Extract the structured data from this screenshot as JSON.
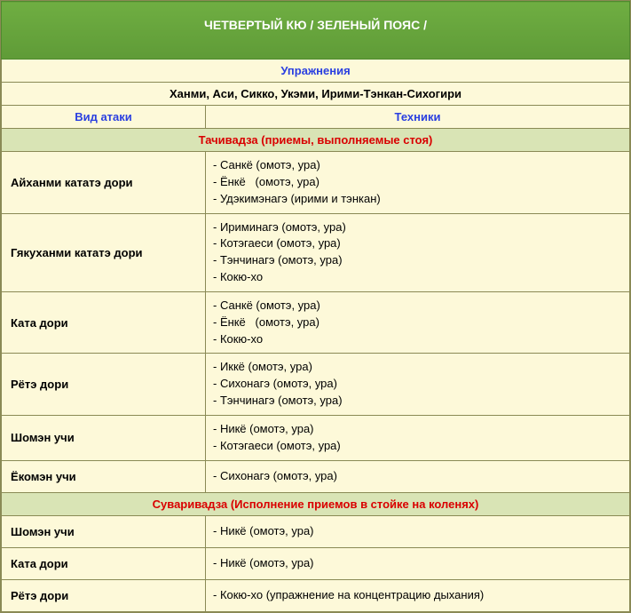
{
  "title": "ЧЕТВЕРТЫЙ КЮ / ЗЕЛЕНЫЙ ПОЯС /",
  "sub_exercises": "Упражнения",
  "sub_list": "Ханми, Аси, Сикко, Укэми, Ирими-Тэнкан-Сихогири",
  "col_attack": "Вид атаки",
  "col_tech": "Техники",
  "section1": "Тачивадза (приемы, выполняемые стоя)",
  "s1": {
    "r0": {
      "atk": "Айханми кататэ дори",
      "t0": "- Санкё (омотэ, ура)",
      "t1": "- Ёнкё   (омотэ, ура)",
      "t2": "- Удэкимэнагэ (ирими и тэнкан)"
    },
    "r1": {
      "atk": "Гякуханми кататэ дори",
      "t0": "- Ириминагэ (омотэ, ура)",
      "t1": "- Котэгаеси (омотэ, ура)",
      "t2": "- Тэнчинагэ (омотэ, ура)",
      "t3": "- Кокю-хо"
    },
    "r2": {
      "atk": "Ката дори",
      "t0": "- Санкё (омотэ, ура)",
      "t1": "- Ёнкё   (омотэ, ура)",
      "t2": "- Кокю-хо"
    },
    "r3": {
      "atk": "Рётэ дори",
      "t0": "- Иккё (омотэ, ура)",
      "t1": "- Сихонагэ (омотэ, ура)",
      "t2": "- Тэнчинагэ (омотэ, ура)"
    },
    "r4": {
      "atk": "Шомэн учи",
      "t0": "- Никё (омотэ, ура)",
      "t1": "- Котэгаеси (омотэ, ура)"
    },
    "r5": {
      "atk": "Ёкомэн учи",
      "t0": "- Сихонагэ (омотэ, ура)"
    }
  },
  "section2": "Суваривадза  (Исполнение приемов в стойке на коленях)",
  "s2": {
    "r0": {
      "atk": "Шомэн учи",
      "t0": "- Никё (омотэ, ура)"
    },
    "r1": {
      "atk": "Ката дори",
      "t0": "- Никё (омотэ, ура)"
    },
    "r2": {
      "atk": "Рётэ дори",
      "t0": "- Кокю-хо (упражнение на концентрацию дыхания)"
    }
  }
}
